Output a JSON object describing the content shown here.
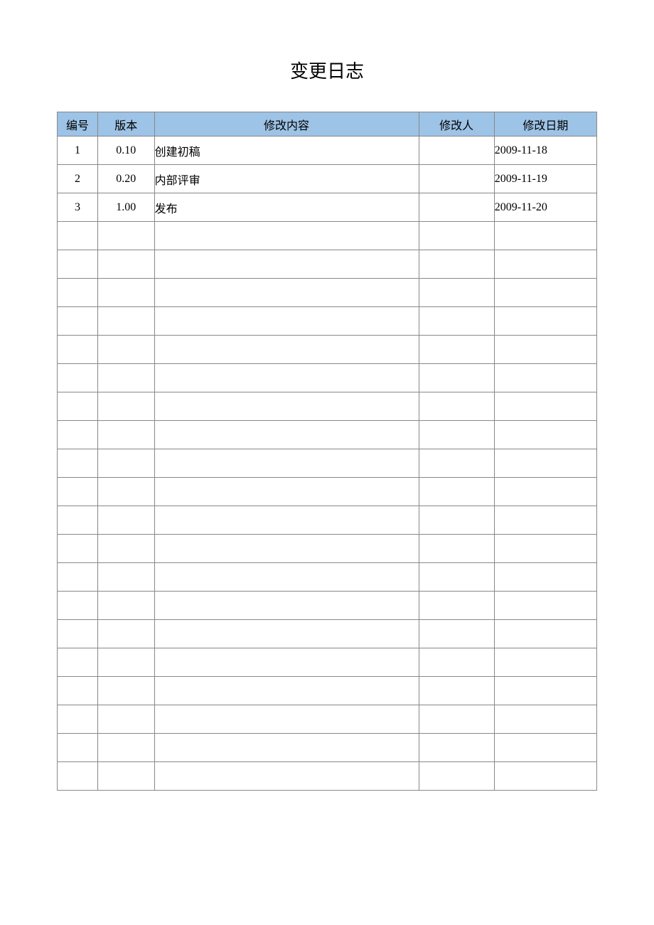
{
  "title": "变更日志",
  "columns": [
    "编号",
    "版本",
    "修改内容",
    "修改人",
    "修改日期"
  ],
  "rows": [
    {
      "id": "1",
      "version": "0.10",
      "content": "创建初稿",
      "author": "",
      "date": "2009-11-18"
    },
    {
      "id": "2",
      "version": "0.20",
      "content": "内部评审",
      "author": "",
      "date": "2009-11-19"
    },
    {
      "id": "3",
      "version": "1.00",
      "content": "发布",
      "author": "",
      "date": "2009-11-20"
    },
    {
      "id": "",
      "version": "",
      "content": "",
      "author": "",
      "date": ""
    },
    {
      "id": "",
      "version": "",
      "content": "",
      "author": "",
      "date": ""
    },
    {
      "id": "",
      "version": "",
      "content": "",
      "author": "",
      "date": ""
    },
    {
      "id": "",
      "version": "",
      "content": "",
      "author": "",
      "date": ""
    },
    {
      "id": "",
      "version": "",
      "content": "",
      "author": "",
      "date": ""
    },
    {
      "id": "",
      "version": "",
      "content": "",
      "author": "",
      "date": ""
    },
    {
      "id": "",
      "version": "",
      "content": "",
      "author": "",
      "date": ""
    },
    {
      "id": "",
      "version": "",
      "content": "",
      "author": "",
      "date": ""
    },
    {
      "id": "",
      "version": "",
      "content": "",
      "author": "",
      "date": ""
    },
    {
      "id": "",
      "version": "",
      "content": "",
      "author": "",
      "date": ""
    },
    {
      "id": "",
      "version": "",
      "content": "",
      "author": "",
      "date": ""
    },
    {
      "id": "",
      "version": "",
      "content": "",
      "author": "",
      "date": ""
    },
    {
      "id": "",
      "version": "",
      "content": "",
      "author": "",
      "date": ""
    },
    {
      "id": "",
      "version": "",
      "content": "",
      "author": "",
      "date": ""
    },
    {
      "id": "",
      "version": "",
      "content": "",
      "author": "",
      "date": ""
    },
    {
      "id": "",
      "version": "",
      "content": "",
      "author": "",
      "date": ""
    },
    {
      "id": "",
      "version": "",
      "content": "",
      "author": "",
      "date": ""
    },
    {
      "id": "",
      "version": "",
      "content": "",
      "author": "",
      "date": ""
    },
    {
      "id": "",
      "version": "",
      "content": "",
      "author": "",
      "date": ""
    },
    {
      "id": "",
      "version": "",
      "content": "",
      "author": "",
      "date": ""
    }
  ]
}
